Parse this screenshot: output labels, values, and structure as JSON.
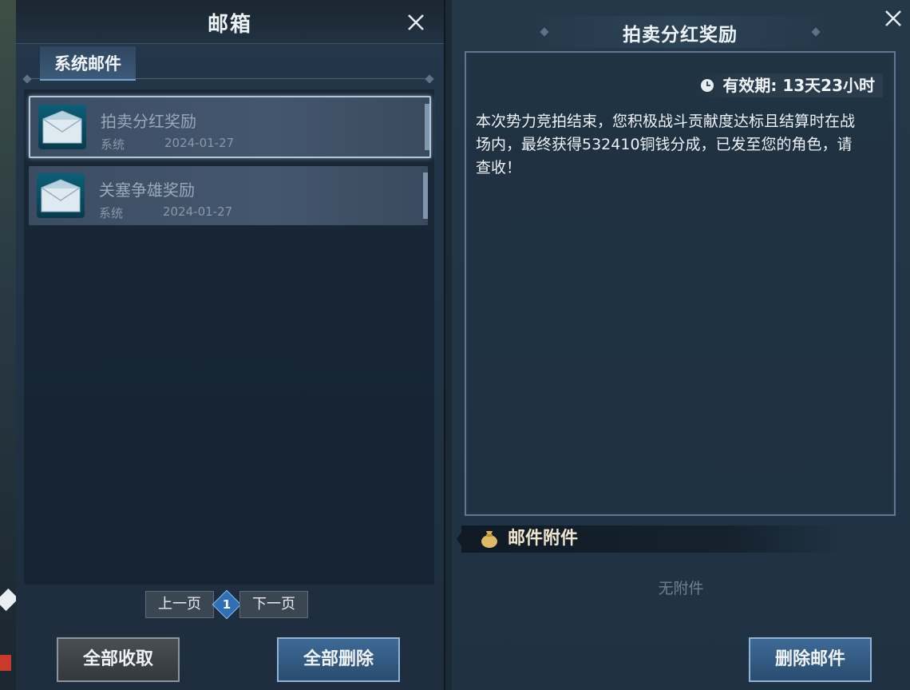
{
  "left": {
    "title": "邮箱",
    "tab_label": "系统邮件",
    "mails": [
      {
        "title": "拍卖分红奖励",
        "sender": "系统",
        "date": "2024-01-27",
        "selected": true
      },
      {
        "title": "关塞争雄奖励",
        "sender": "系统",
        "date": "2024-01-27",
        "selected": false
      }
    ],
    "pager": {
      "prev_label": "上一页",
      "page": "1",
      "next_label": "下一页"
    },
    "collect_all_label": "全部收取",
    "delete_all_label": "全部删除"
  },
  "right": {
    "title": "拍卖分红奖励",
    "validity": "有效期: 13天23小时",
    "body": "本次势力竞拍结束，您积极战斗贡献度达标且结算时在战场内，最终获得532410铜钱分成，已发至您的角色，请查收！",
    "attachment_label": "邮件附件",
    "no_attachment_text": "无附件",
    "delete_mail_label": "删除邮件"
  },
  "icons": [
    "close-icon",
    "envelope-icon",
    "clock-icon",
    "money-bag-icon"
  ],
  "colors": {
    "accent_blue": "#2e6fb6",
    "panel_bg": "#24374a",
    "text_light": "#eef3f7"
  }
}
